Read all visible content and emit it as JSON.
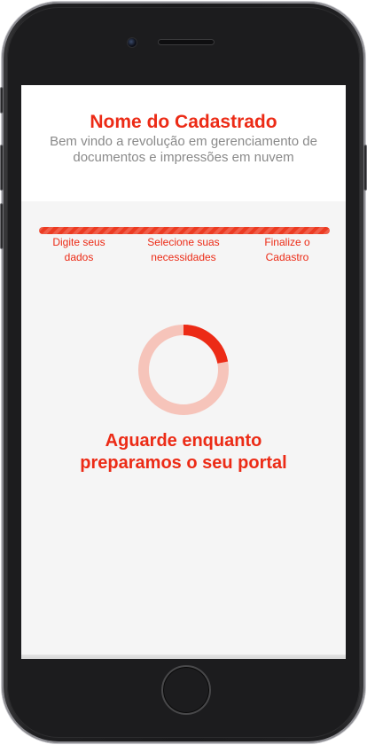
{
  "header": {
    "title": "Nome do Cadastrado",
    "subtitle_line1": "Bem vindo a revolução em gerenciamento de",
    "subtitle_line2": "documentos e impressões em nuvem"
  },
  "progress": {
    "value": 1.0
  },
  "steps": [
    {
      "line1": "Digite seus",
      "line2": "dados"
    },
    {
      "line1": "Selecione suas",
      "line2": "necessidades"
    },
    {
      "line1": "Finalize o",
      "line2": "Cadastro"
    }
  ],
  "spinner": {
    "arc_fraction": 0.22
  },
  "message": {
    "line1": "Aguarde enquanto",
    "line2": "preparamos o seu portal"
  },
  "colors": {
    "accent": "#ec2b16",
    "accent_light": "#f6c4ba",
    "subtitle": "#8a8a8a",
    "screen_bg": "#f5f5f5",
    "phone_body": "#1c1c1e"
  }
}
